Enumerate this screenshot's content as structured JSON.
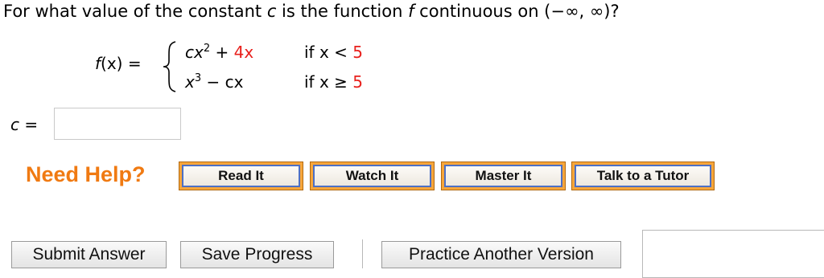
{
  "question": {
    "prefix": "For what value of the constant ",
    "var_c": "c",
    "middle": " is the function ",
    "var_f": "f",
    "suffix": " continuous on (−∞, ∞)?"
  },
  "function": {
    "lhs_f": "f",
    "lhs_rest": "(x) =",
    "piece1": {
      "expr_c": "cx",
      "expr_exp": "2",
      "expr_plus": " + ",
      "expr_term": "4x",
      "cond_text": "if x < ",
      "cond_value": "5"
    },
    "piece2": {
      "expr_x": "x",
      "expr_exp": "3",
      "expr_minus": " − cx",
      "cond_text": "if x ≥ ",
      "cond_value": "5"
    }
  },
  "answer": {
    "label_var": "c",
    "label_eq": " =",
    "value": ""
  },
  "help": {
    "title": "Need Help?",
    "buttons": [
      "Read It",
      "Watch It",
      "Master It",
      "Talk to a Tutor"
    ]
  },
  "actions": {
    "submit": "Submit Answer",
    "save": "Save Progress",
    "practice": "Practice Another Version"
  },
  "colors": {
    "accent_orange": "#f07a12",
    "help_button_border": "#4d70c5",
    "red_value": "#e8201c"
  }
}
